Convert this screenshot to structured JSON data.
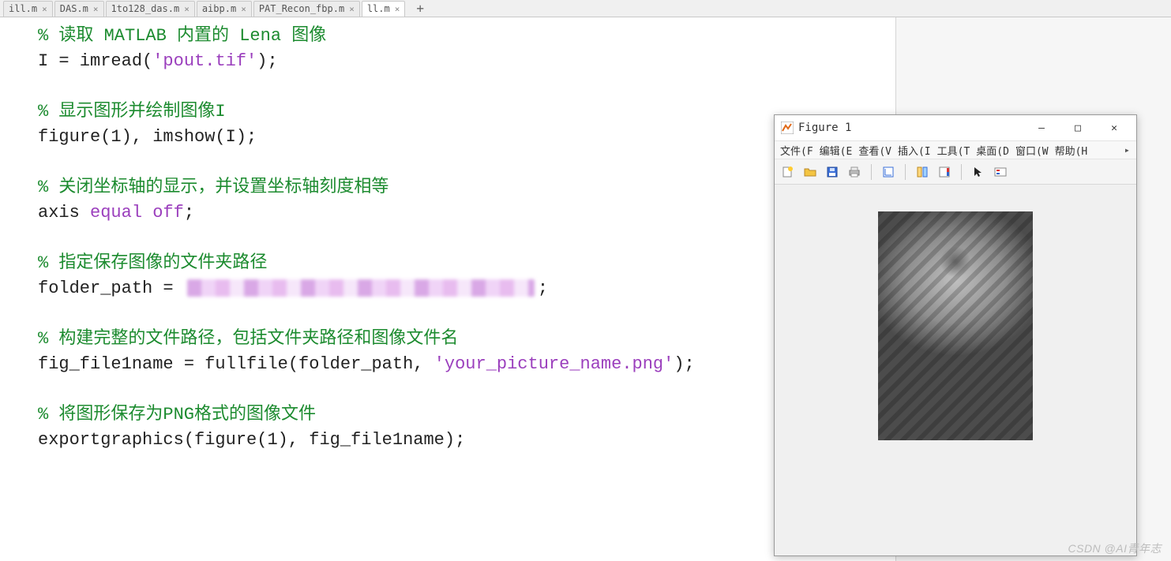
{
  "tabs": [
    {
      "label": "ill.m"
    },
    {
      "label": "DAS.m"
    },
    {
      "label": "1to128_das.m"
    },
    {
      "label": "aibp.m"
    },
    {
      "label": "PAT_Recon_fbp.m"
    },
    {
      "label": "ll.m"
    }
  ],
  "tab_close": "×",
  "tab_add": "+",
  "code": {
    "l1_1": "% ",
    "l1_2": "读取 MATLAB 内置的 Lena 图像",
    "l2_1": "I = imread(",
    "l2_2": "'pout.tif'",
    "l2_3": ");",
    "l4_1": "% ",
    "l4_2": "显示图形并绘制图像I",
    "l5_1": "figure(1), imshow(I);",
    "l7_1": "% ",
    "l7_2": "关闭坐标轴的显示，并设置坐标轴刻度相等",
    "l8_1": "axis ",
    "l8_2": "equal off",
    "l8_3": ";",
    "l10_1": "% ",
    "l10_2": "指定保存图像的文件夹路径",
    "l11_1": "folder_path = ",
    "l11_2": ";",
    "l13_1": "% ",
    "l13_2": "构建完整的文件路径，包括文件夹路径和图像文件名",
    "l14_1": "fig_file1name = fullfile(folder_path, ",
    "l14_2": "'your_picture_name.png'",
    "l14_3": ");",
    "l16_1": "% ",
    "l16_2": "将图形保存为PNG格式的图像文件",
    "l17_1": "exportgraphics(figure(1), fig_file1name);"
  },
  "figure": {
    "title": "Figure 1",
    "menu": {
      "file": "文件(F",
      "edit": "编辑(E",
      "view": "查看(V",
      "insert": "插入(I",
      "tools": "工具(T",
      "desktop": "桌面(D",
      "window": "窗口(W",
      "help": "帮助(H"
    },
    "menu_arrow": "▸"
  },
  "win_btn": {
    "min": "—",
    "max": "□",
    "close": "✕"
  },
  "watermark": "CSDN @AI青年志"
}
